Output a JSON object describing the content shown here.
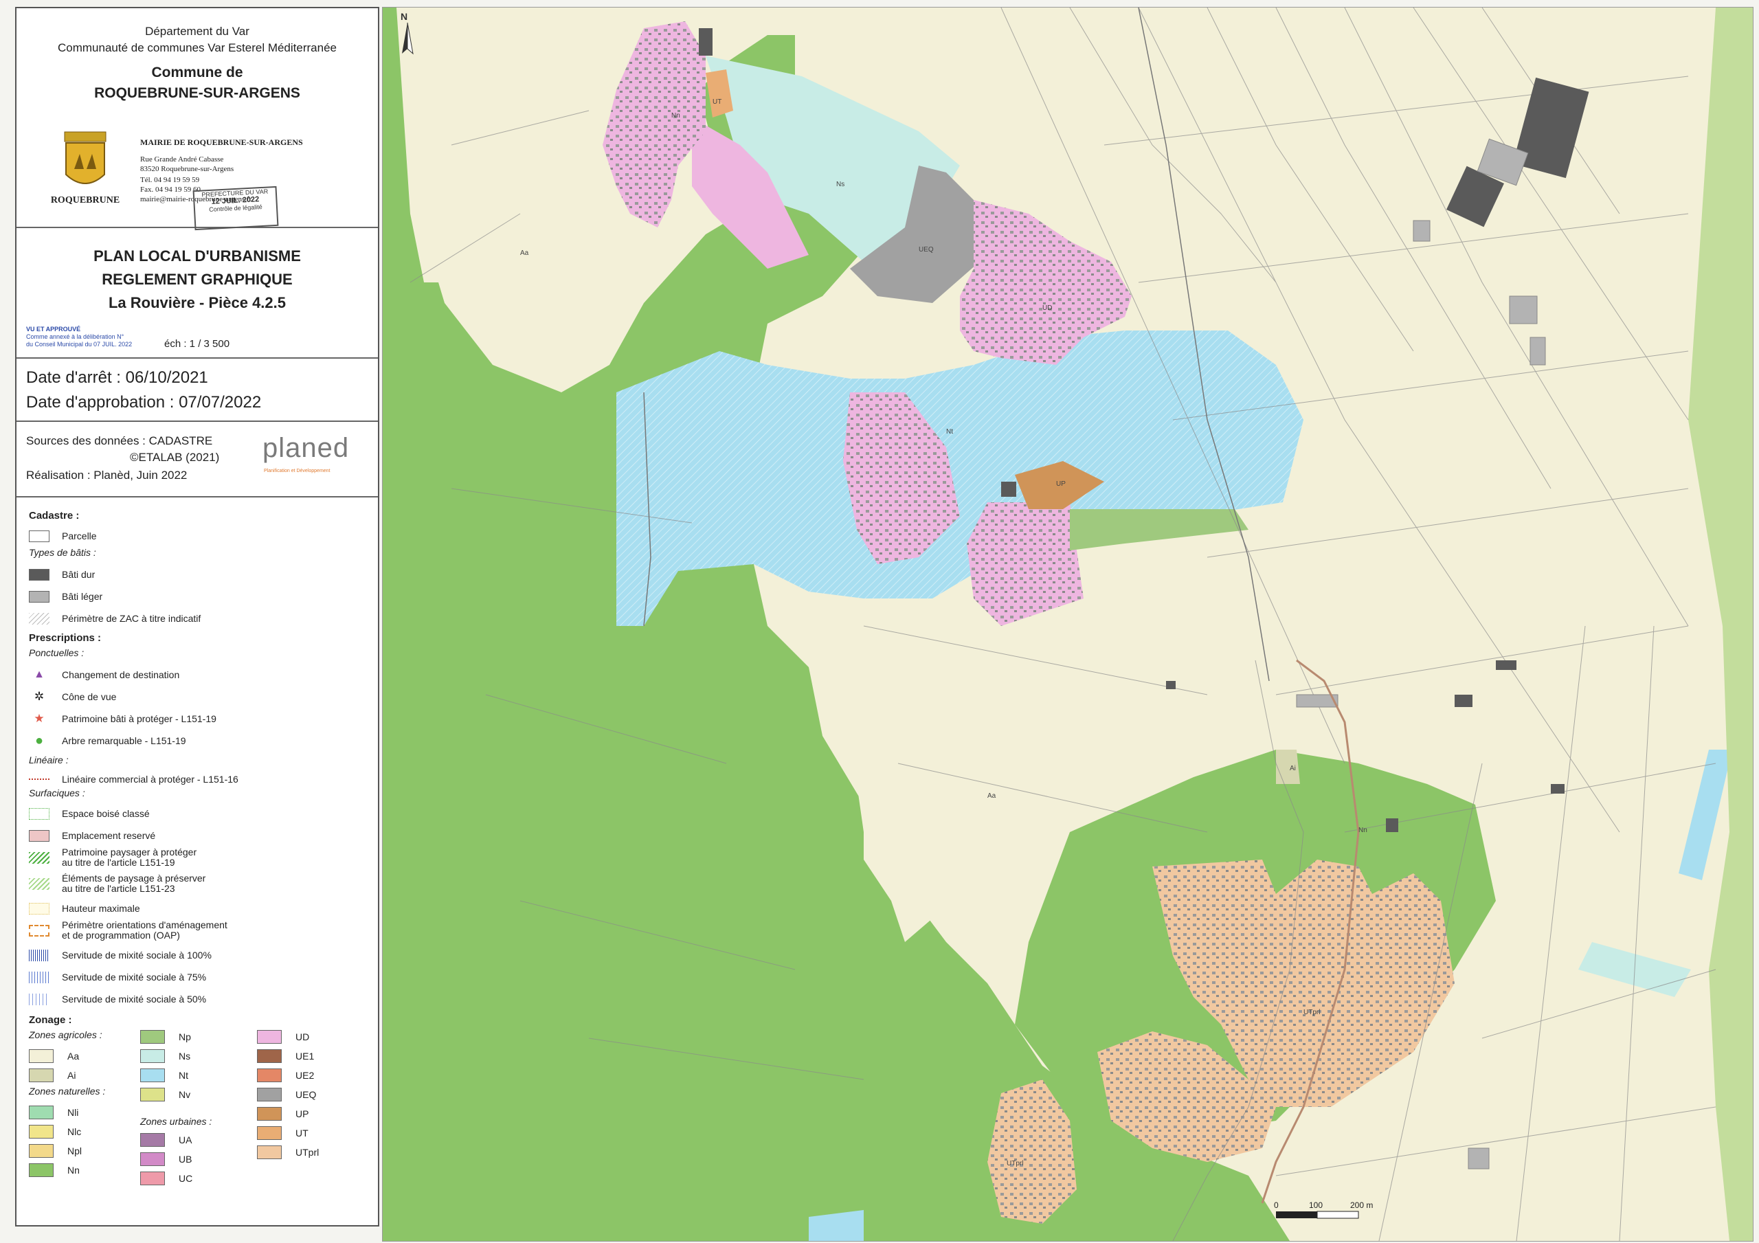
{
  "header": {
    "dept": "Département du Var",
    "community": "Communauté de communes Var Esterel Méditerranée",
    "commune_prefix": "Commune de",
    "commune_name": "ROQUEBRUNE-SUR-ARGENS",
    "mairie": "MAIRIE DE ROQUEBRUNE-SUR-ARGENS",
    "address1": "Rue Grande André Cabasse",
    "address2": "83520 Roquebrune-sur-Argens",
    "tel": "Tél. 04 94 19 59 59",
    "fax": "Fax. 04 94 19 59 60",
    "email": "mairie@mairie-roquebrune-argens.fr",
    "logo_text": "ROQUEBRUNE",
    "stamp_line1": "PREFECTURE DU VAR",
    "stamp_line2": "12 JUIL. 2022",
    "stamp_line3": "Contrôle de légalité"
  },
  "title": {
    "line1": "PLAN LOCAL D'URBANISME",
    "line2": "REGLEMENT GRAPHIQUE",
    "line3": "La Rouvière - Pièce 4.2.5",
    "stamp_text1": "VU ET APPROUVÉ",
    "stamp_text2": "Comme annexé à la délibération N°",
    "stamp_text3": "du Conseil Municipal du 07 JUIL. 2022",
    "scale": "éch : 1 / 3 500"
  },
  "dates": {
    "arret": "Date d'arrêt : 06/10/2021",
    "approbation": "Date d'approbation : 07/07/2022"
  },
  "sources": {
    "line1": "Sources des données : CADASTRE",
    "line2": "©ETALAB (2021)",
    "line3": "Réalisation : Planèd, Juin 2022",
    "logo": "planed",
    "logo_sub": "Planification et Développement"
  },
  "legend": {
    "cadastre_h": "Cadastre :",
    "parcelle": "Parcelle",
    "types_bati": "Types de bâtis :",
    "bati_dur": "Bâti dur",
    "bati_leger": "Bâti léger",
    "zac": "Périmètre de ZAC à titre indicatif",
    "prescriptions_h": "Prescriptions :",
    "ponctuelles": "Ponctuelles :",
    "changement": "Changement de destination",
    "cone": "Cône de vue",
    "patrimoine_bati": "Patrimoine bâti à protéger - L151-19",
    "arbre": "Arbre remarquable - L151-19",
    "lineaire": "Linéaire :",
    "lineaire_commercial": "Linéaire commercial à protéger - L151-16",
    "surfaciques": "Surfaciques :",
    "ebc": "Espace boisé classé",
    "emplacement": "Emplacement reservé",
    "patrimoine_paysager_1": "Patrimoine paysager à protéger",
    "patrimoine_paysager_2": "au titre de l'article L151-19",
    "elements_paysage_1": "Éléments de paysage à préserver",
    "elements_paysage_2": "au titre de l'article L151-23",
    "hauteur": "Hauteur maximale",
    "oap_1": "Périmètre orientations d'aménagement",
    "oap_2": "et de programmation (OAP)",
    "sms100": "Servitude de mixité sociale à 100%",
    "sms75": "Servitude de mixité sociale à 75%",
    "sms50": "Servitude de mixité sociale à 50%",
    "zonage_h": "Zonage :",
    "zones_agricoles": "Zones agricoles :",
    "zones_naturelles": "Zones naturelles :",
    "zones_urbaines": "Zones urbaines :",
    "zones": {
      "Aa": "Aa",
      "Ai": "Ai",
      "Nli": "Nli",
      "Nlc": "Nlc",
      "Npl": "Npl",
      "Nn": "Nn",
      "Np": "Np",
      "Ns": "Ns",
      "Nt": "Nt",
      "Nv": "Nv",
      "UA": "UA",
      "UB": "UB",
      "UC": "UC",
      "UD": "UD",
      "UE1": "UE1",
      "UE2": "UE2",
      "UEQ": "UEQ",
      "UP": "UP",
      "UT": "UT",
      "UTprl": "UTprl"
    }
  },
  "map": {
    "north": "N",
    "scale_0": "0",
    "scale_100": "100",
    "scale_200": "200 m",
    "labels": {
      "UT": "UT",
      "Ns": "Ns",
      "Nn": "Nn",
      "UD": "UD",
      "UEQ": "UEQ",
      "Nt": "Nt",
      "Aa": "Aa",
      "UTprl": "UTprl",
      "UP": "UP",
      "Np": "Np",
      "Ai": "Ai"
    }
  },
  "colors": {
    "Aa": "#f3f0d8",
    "Ai": "#d6d7b0",
    "Nli": "#9fdcb0",
    "Nlc": "#f1e58a",
    "Npl": "#f3d98a",
    "Nn": "#8cc567",
    "Np": "#9fc97e",
    "Ns": "#c8ece6",
    "Nt": "#a8def0",
    "Nv": "#dde28a",
    "UA": "#a57aa6",
    "UB": "#d28ac7",
    "UC": "#ee9aa9",
    "UD": "#eeb6e0",
    "UE1": "#9f6549",
    "UE2": "#e48766",
    "UEQ": "#a1a1a1",
    "UP": "#d09458",
    "UT": "#e9ad74",
    "UTprl": "#f1c8a0"
  }
}
